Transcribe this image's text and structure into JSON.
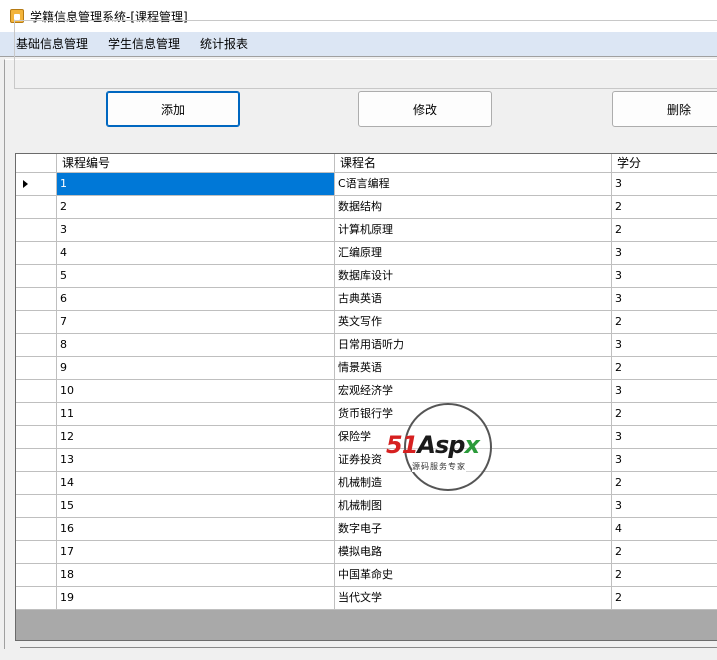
{
  "window": {
    "title": "学籍信息管理系统-[课程管理]"
  },
  "menu": [
    "基础信息管理",
    "学生信息管理",
    "统计报表"
  ],
  "toolbar": {
    "add_label": "添加",
    "edit_label": "修改",
    "delete_label": "删除"
  },
  "grid": {
    "columns": [
      "课程编号",
      "课程名",
      "学分"
    ],
    "selected_row": 0,
    "rows": [
      {
        "id": "1",
        "name": "C语言编程",
        "credit": "3"
      },
      {
        "id": "2",
        "name": "数据结构",
        "credit": "2"
      },
      {
        "id": "3",
        "name": "计算机原理",
        "credit": "2"
      },
      {
        "id": "4",
        "name": "汇编原理",
        "credit": "3"
      },
      {
        "id": "5",
        "name": "数据库设计",
        "credit": "3"
      },
      {
        "id": "6",
        "name": "古典英语",
        "credit": "3"
      },
      {
        "id": "7",
        "name": "英文写作",
        "credit": "2"
      },
      {
        "id": "8",
        "name": "日常用语听力",
        "credit": "3"
      },
      {
        "id": "9",
        "name": "情景英语",
        "credit": "2"
      },
      {
        "id": "10",
        "name": "宏观经济学",
        "credit": "3"
      },
      {
        "id": "11",
        "name": "货币银行学",
        "credit": "2"
      },
      {
        "id": "12",
        "name": "保险学",
        "credit": "3"
      },
      {
        "id": "13",
        "name": "证券投资",
        "credit": "3"
      },
      {
        "id": "14",
        "name": "机械制造",
        "credit": "2"
      },
      {
        "id": "15",
        "name": "机械制图",
        "credit": "3"
      },
      {
        "id": "16",
        "name": "数字电子",
        "credit": "4"
      },
      {
        "id": "17",
        "name": "模拟电路",
        "credit": "2"
      },
      {
        "id": "18",
        "name": "中国革命史",
        "credit": "2"
      },
      {
        "id": "19",
        "name": "当代文学",
        "credit": "2"
      }
    ]
  },
  "watermark": {
    "logo_51": "51",
    "logo_asp": "Asp",
    "logo_x": "x",
    "sub": "源码服务专家"
  },
  "colors": {
    "selection": "#0078d7",
    "menubar": "#dce6f4",
    "grid_bg": "#a9a9a9"
  }
}
